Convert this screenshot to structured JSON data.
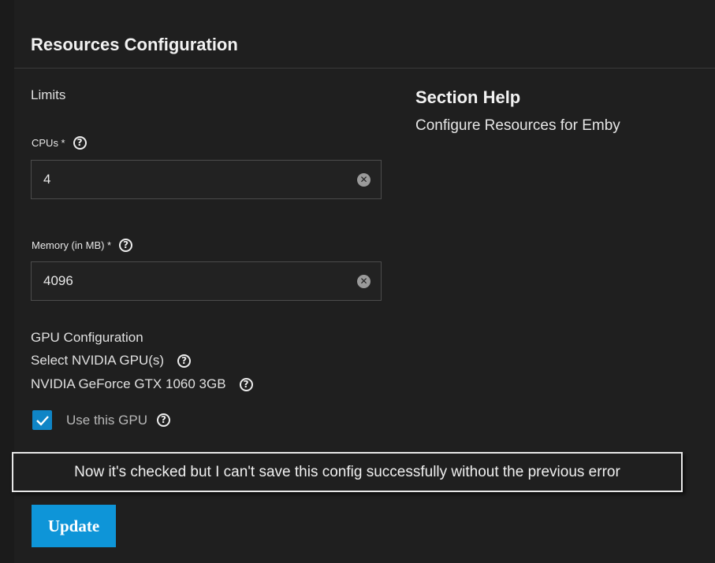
{
  "header": {
    "title": "Resources Configuration"
  },
  "limits": {
    "section_label": "Limits",
    "cpus": {
      "label": "CPUs *",
      "value": "4"
    },
    "memory": {
      "label": "Memory (in MB) *",
      "value": "4096"
    }
  },
  "gpu": {
    "section_label": "GPU Configuration",
    "select_label": "Select NVIDIA GPU(s)",
    "gpu_name": "NVIDIA GeForce GTX 1060 3GB",
    "use_label": "Use this GPU",
    "use_checked": true
  },
  "annotation": {
    "text": "Now it's checked but I can't save this config successfully without the previous error"
  },
  "actions": {
    "update_label": "Update"
  },
  "help": {
    "title": "Section Help",
    "text": "Configure Resources for Emby"
  },
  "icons": {
    "help": "question-circle-icon",
    "clear": "clear-circle-icon",
    "check": "check-icon"
  },
  "colors": {
    "background": "#1f1f1f",
    "accent": "#0e95d8",
    "checkbox": "#0f85c6"
  }
}
